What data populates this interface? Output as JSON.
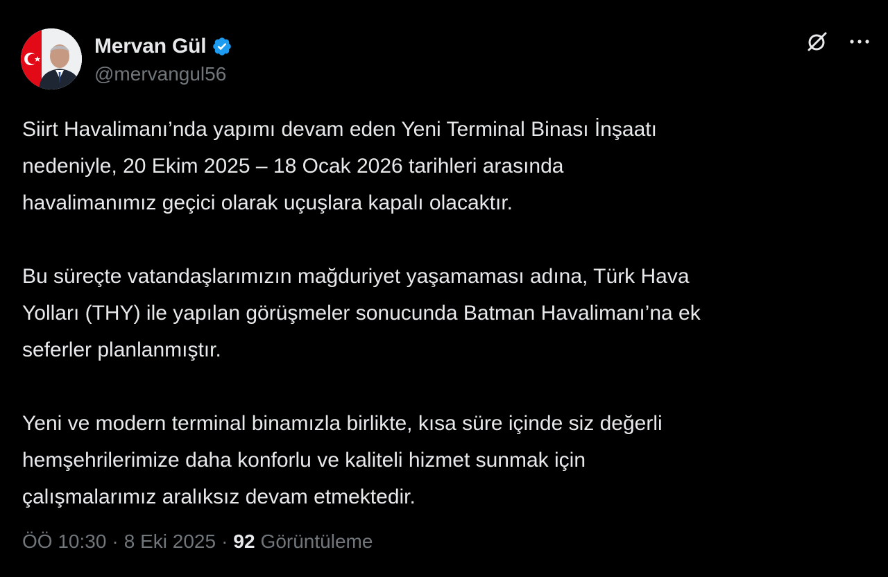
{
  "author": {
    "display_name": "Mervan Gül",
    "handle": "@mervangul56",
    "verified": true,
    "verified_color": "#1d9bf0"
  },
  "post": {
    "paragraphs": [
      "Siirt Havalimanı’nda yapımı devam eden Yeni Terminal Binası İnşaatı\nnedeniyle, 20 Ekim 2025 – 18 Ocak 2026 tarihleri arasında\nhavalimanımız geçici olarak uçuşlara kapalı olacaktır.",
      "Bu süreçte vatandaşlarımızın mağduriyet yaşamaması adına, Türk Hava\nYolları (THY) ile yapılan görüşmeler sonucunda Batman Havalimanı’na ek\nseferler planlanmıştır.",
      "Yeni ve modern terminal binamızla birlikte, kısa süre içinde siz değerli\nhemşehrilerimize daha konforlu ve kaliteli hizmet sunmak için\nçalışmalarımız aralıksız devam etmektedir."
    ]
  },
  "meta": {
    "time": "ÖÖ 10:30",
    "separator": "·",
    "date": "8 Eki 2025",
    "views_count": "92",
    "views_label": "Görüntüleme"
  },
  "icons": {
    "grok": "grok-icon",
    "more": "more-icon"
  },
  "colors": {
    "background": "#000000",
    "text_primary": "#e7e9ea",
    "text_secondary": "#71767b",
    "flag_red": "#e30a17"
  }
}
